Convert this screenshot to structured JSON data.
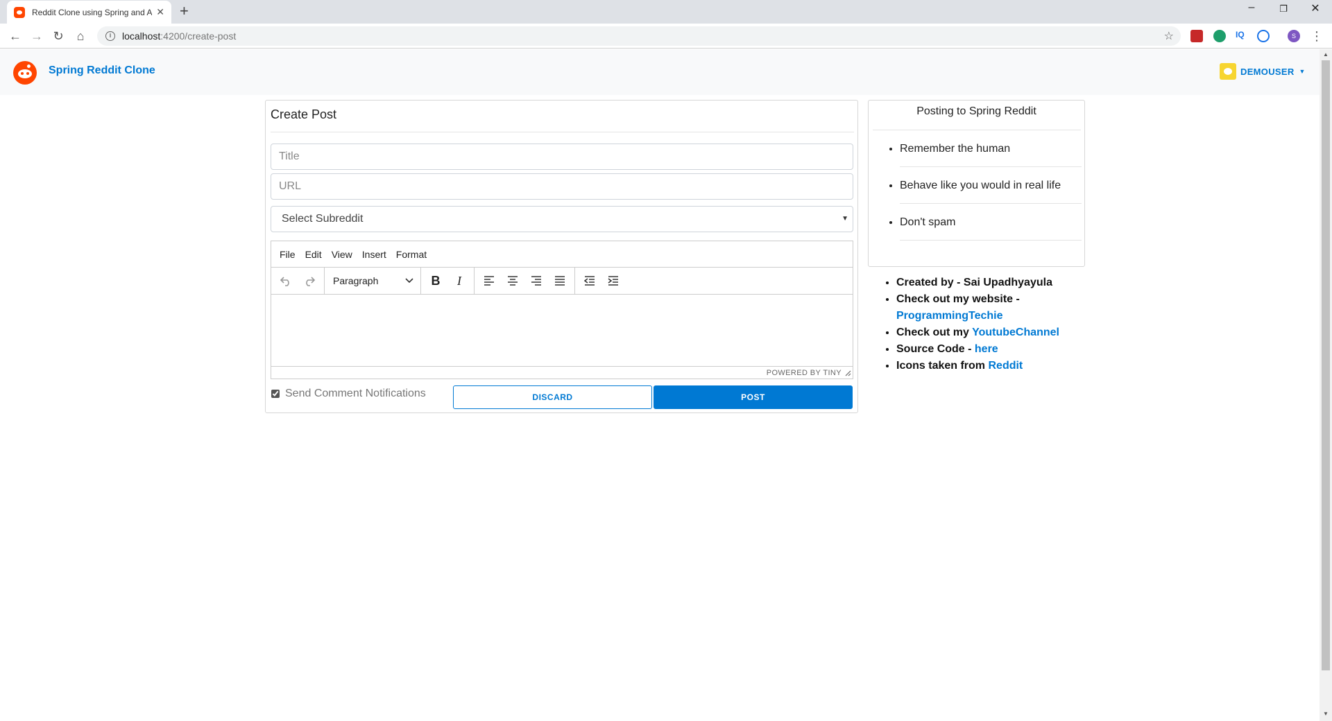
{
  "browser": {
    "tab_title": "Reddit Clone using Spring and A",
    "url_host": "localhost",
    "url_path": ":4200/create-post",
    "profile_initial": "S"
  },
  "navbar": {
    "brand": "Spring Reddit Clone",
    "username": "DEMOUSER"
  },
  "create_post": {
    "heading": "Create Post",
    "title_placeholder": "Title",
    "url_placeholder": "URL",
    "subreddit_selected": "Select Subreddit",
    "editor": {
      "menus": [
        "File",
        "Edit",
        "View",
        "Insert",
        "Format"
      ],
      "block_format": "Paragraph",
      "powered_by": "POWERED BY TINY"
    },
    "notifications_label": "Send Comment Notifications",
    "notifications_checked": true,
    "discard_label": "DISCARD",
    "post_label": "POST"
  },
  "sidebar": {
    "rules_title": "Posting to Spring Reddit",
    "rules": [
      "Remember the human",
      "Behave like you would in real life",
      "Don't spam"
    ],
    "credits": {
      "created_by": "Created by - Sai Upadhyayula",
      "website_prefix": "Check out my website - ",
      "website_link": "ProgrammingTechie",
      "youtube_prefix": "Check out my ",
      "youtube_link": "YoutubeChannel",
      "source_prefix": "Source Code - ",
      "source_link": "here",
      "icons_prefix": "Icons taken from ",
      "icons_link": "Reddit"
    }
  },
  "colors": {
    "primary": "#0079d3",
    "reddit_orange": "#ff4500",
    "navbar_bg": "#f8f9fa"
  }
}
